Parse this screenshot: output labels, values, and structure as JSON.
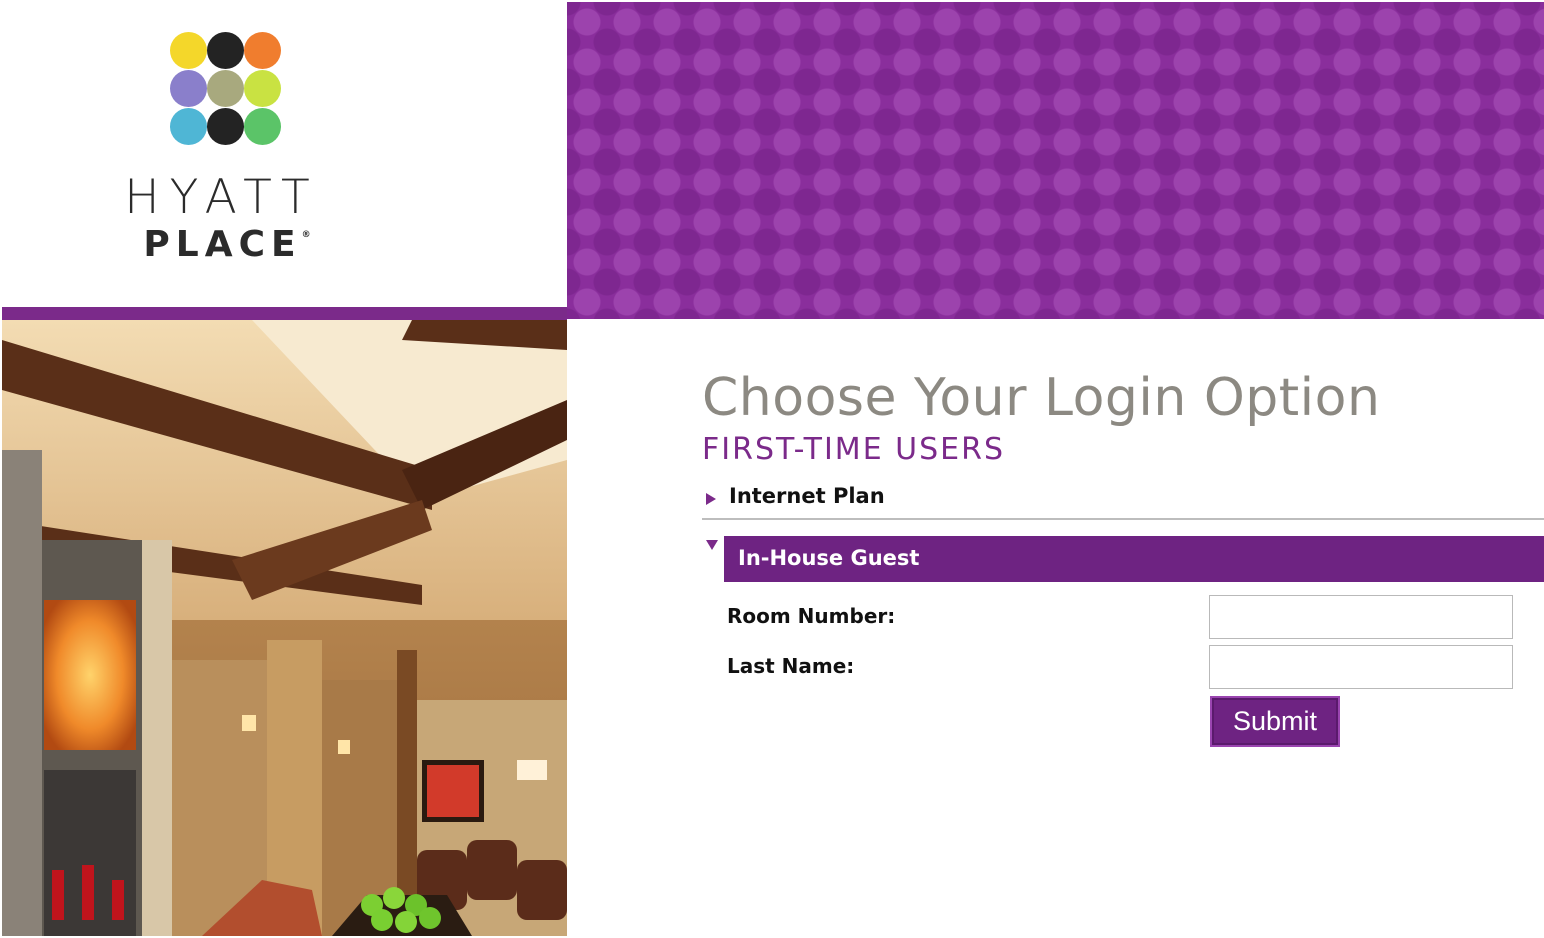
{
  "brand": {
    "line1": "HYATT",
    "line2": "PLACE",
    "registered_mark": "®",
    "dot_colors": [
      "#f4d72a",
      "#232323",
      "#f07d2e",
      "#8a7fcb",
      "#a8a97e",
      "#c9e242",
      "#4fb6d5",
      "#232323",
      "#5bc468"
    ],
    "accent_color": "#7b2a8a"
  },
  "main": {
    "heading": "Choose Your Login Option",
    "subheading": "FIRST-TIME USERS",
    "internet_plan_label": "Internet Plan",
    "in_house_guest_label": "In-House Guest",
    "form": {
      "room_number_label": "Room Number:",
      "room_number_value": "",
      "last_name_label": "Last Name:",
      "last_name_value": "",
      "submit_label": "Submit"
    }
  }
}
